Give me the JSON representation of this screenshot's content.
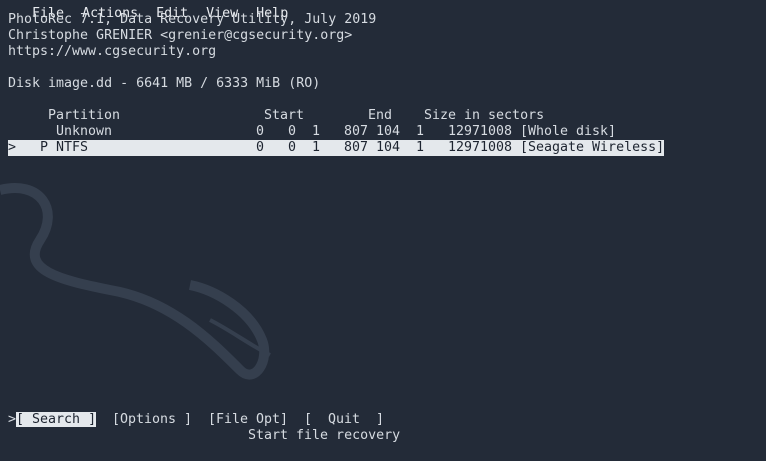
{
  "menubar": [
    "File",
    "Actions",
    "Edit",
    "View",
    "Help"
  ],
  "header": {
    "line1": "PhotoRec 7.1, Data Recovery Utility, July 2019",
    "line2": "Christophe GRENIER <grenier@cgsecurity.org>",
    "line3": "https://www.cgsecurity.org"
  },
  "disk": "Disk image.dd - 6641 MB / 6333 MiB (RO)",
  "table": {
    "headers": {
      "partition": "Partition",
      "start": "Start",
      "end": "End",
      "size": "Size in sectors"
    },
    "rows": [
      {
        "marker": "",
        "flag": "",
        "type": "Unknown",
        "start": "0   0  1",
        "end": "807 104  1",
        "size": "12971008",
        "label": "[Whole disk]",
        "selected": false
      },
      {
        "marker": ">",
        "flag": "P",
        "type": "NTFS",
        "start": "0   0  1",
        "end": "807 104  1",
        "size": "12971008",
        "label": "[Seagate Wireless]",
        "selected": true
      }
    ]
  },
  "menu": {
    "cursor": ">",
    "search": "[ Search ]",
    "options": "[Options ]",
    "fileopt": "[File Opt]",
    "quit": "[  Quit  ]",
    "hint": "Start file recovery"
  }
}
